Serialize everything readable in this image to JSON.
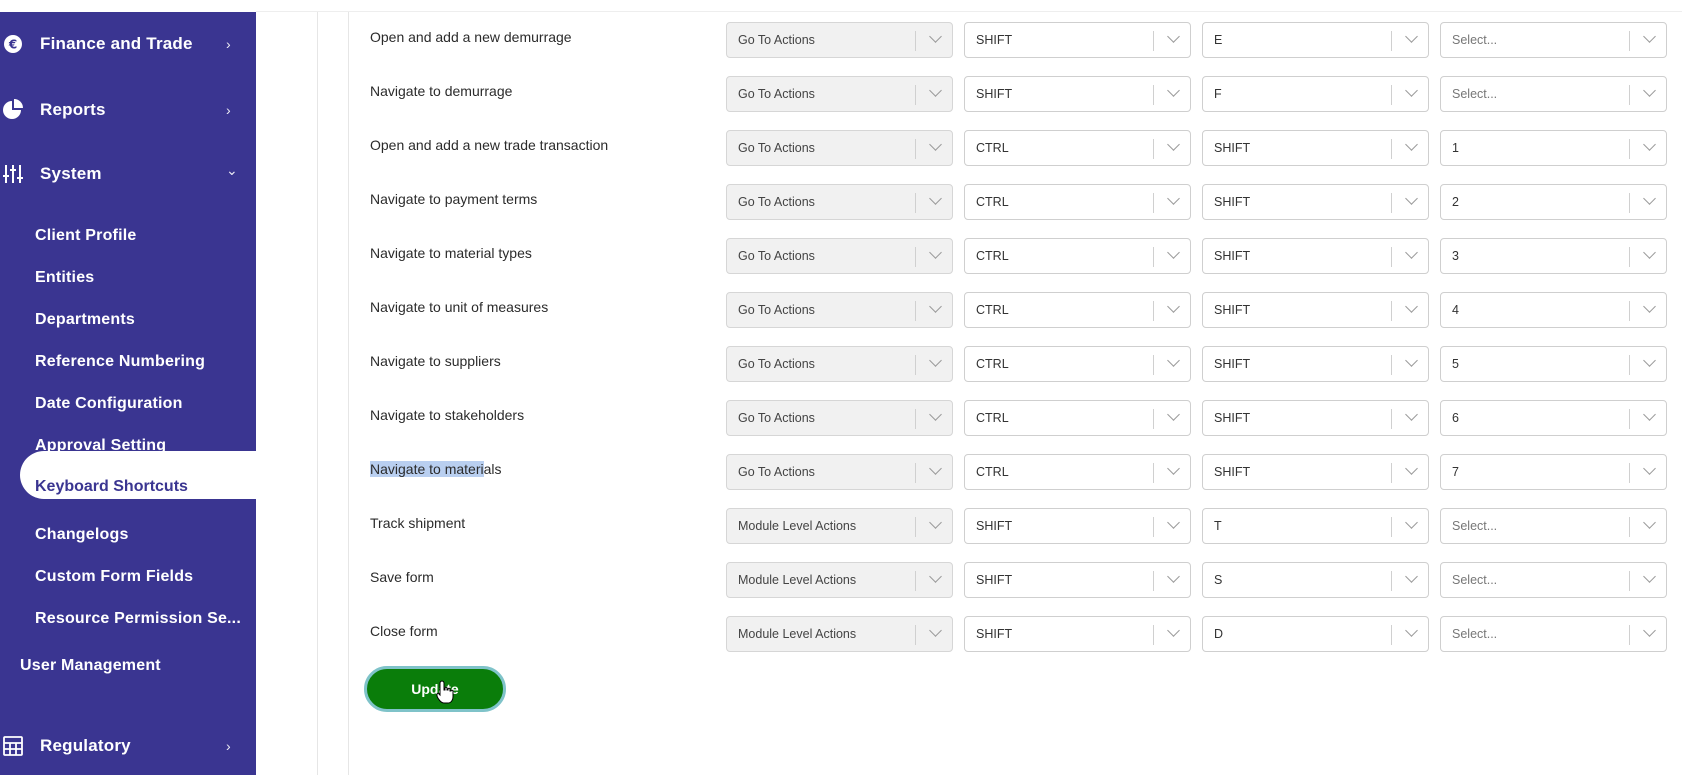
{
  "sidebar": {
    "top_items": [
      {
        "label": "Finance and Trade",
        "icon": "euro-icon",
        "chevron": "›"
      },
      {
        "label": "Reports",
        "icon": "pie-chart-icon",
        "chevron": "›"
      },
      {
        "label": "System",
        "icon": "sliders-icon",
        "chevron": "⌄"
      }
    ],
    "system_items": [
      "Client Profile",
      "Entities",
      "Departments",
      "Reference Numbering",
      "Date Configuration",
      "Approval Setting",
      "Keyboard Shortcuts",
      "Changelogs",
      "Custom Form Fields",
      "Resource Permission Se..."
    ],
    "active_item": "Keyboard Shortcuts",
    "user_management": "User Management",
    "regulatory": {
      "label": "Regulatory",
      "icon": "calculator-icon",
      "chevron": "›"
    },
    "colors": {
      "background": "#3a3591",
      "text": "#ffffff"
    }
  },
  "shortcuts": [
    {
      "action": "Open and add a new demurrage",
      "group": "Go To Actions",
      "key1": "SHIFT",
      "key2": "E",
      "key3": "Select..."
    },
    {
      "action": "Navigate to demurrage",
      "group": "Go To Actions",
      "key1": "SHIFT",
      "key2": "F",
      "key3": "Select..."
    },
    {
      "action": "Open and add a new trade transaction",
      "group": "Go To Actions",
      "key1": "CTRL",
      "key2": "SHIFT",
      "key3": "1"
    },
    {
      "action": "Navigate to payment terms",
      "group": "Go To Actions",
      "key1": "CTRL",
      "key2": "SHIFT",
      "key3": "2"
    },
    {
      "action": "Navigate to material types",
      "group": "Go To Actions",
      "key1": "CTRL",
      "key2": "SHIFT",
      "key3": "3"
    },
    {
      "action": "Navigate to unit of measures",
      "group": "Go To Actions",
      "key1": "CTRL",
      "key2": "SHIFT",
      "key3": "4"
    },
    {
      "action": "Navigate to suppliers",
      "group": "Go To Actions",
      "key1": "CTRL",
      "key2": "SHIFT",
      "key3": "5"
    },
    {
      "action": "Navigate to stakeholders",
      "group": "Go To Actions",
      "key1": "CTRL",
      "key2": "SHIFT",
      "key3": "6"
    },
    {
      "action": "Navigate to materials",
      "action_highlight": "Navigate to materi",
      "action_rest": "als",
      "group": "Go To Actions",
      "key1": "CTRL",
      "key2": "SHIFT",
      "key3": "7"
    },
    {
      "action": "Track shipment",
      "group": "Module Level Actions",
      "key1": "SHIFT",
      "key2": "T",
      "key3": "Select..."
    },
    {
      "action": "Save form",
      "group": "Module Level Actions",
      "key1": "SHIFT",
      "key2": "S",
      "key3": "Select..."
    },
    {
      "action": "Close form",
      "group": "Module Level Actions",
      "key1": "SHIFT",
      "key2": "D",
      "key3": "Select..."
    }
  ],
  "update_button": {
    "label": "Update",
    "color": "#0a7d0a"
  }
}
